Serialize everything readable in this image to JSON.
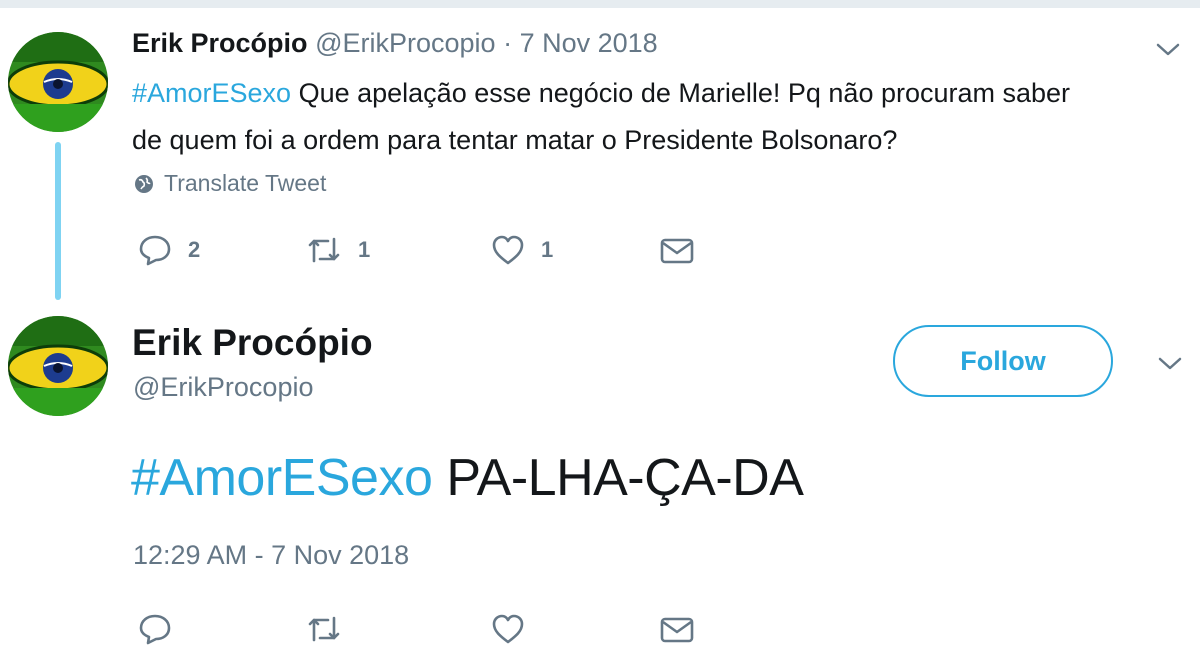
{
  "tweet1": {
    "author_name": "Erik Procópio",
    "handle": "@ErikProcopio",
    "separator": "·",
    "date": "7 Nov 2018",
    "hashtag": "#AmorESexo",
    "text_line1": " Que apelação esse negócio de Marielle! Pq não procuram saber",
    "text_line2": "de quem foi a ordem para tentar matar o Presidente Bolsonaro?",
    "translate_label": "Translate Tweet",
    "actions": {
      "reply_icon": "reply-icon",
      "reply_count": "2",
      "retweet_icon": "retweet-icon",
      "retweet_count": "1",
      "like_icon": "heart-icon",
      "like_count": "1",
      "dm_icon": "envelope-icon"
    }
  },
  "tweet2": {
    "author_name": "Erik Procópio",
    "handle": "@ErikProcopio",
    "follow_label": "Follow",
    "hashtag": "#AmorESexo",
    "text": " PA-LHA-ÇA-DA",
    "timestamp": "12:29 AM - 7 Nov 2018",
    "actions": {
      "reply_icon": "reply-icon",
      "retweet_icon": "retweet-icon",
      "like_icon": "heart-icon",
      "dm_icon": "envelope-icon"
    }
  },
  "colors": {
    "accent": "#2aa7dd",
    "secondary_text": "#657786",
    "primary_text": "#14171a",
    "thread_line": "#7fd3f2"
  }
}
